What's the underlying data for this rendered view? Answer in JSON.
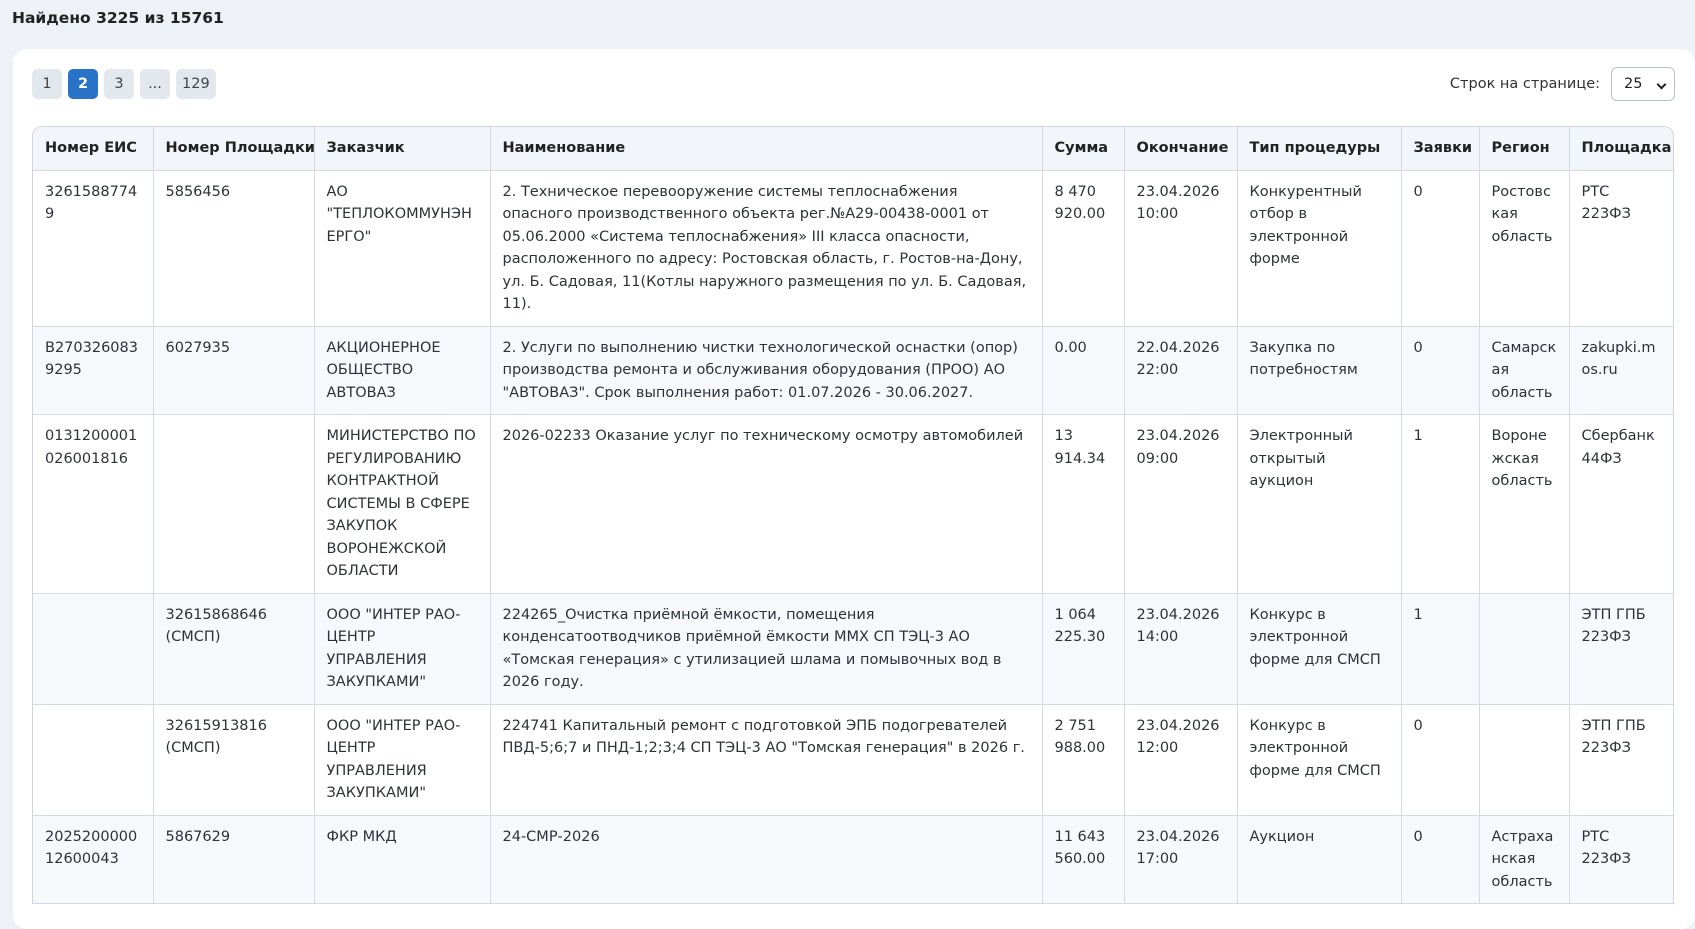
{
  "summary": {
    "found_text": "Найдено 3225 из 15761"
  },
  "pagination": {
    "pages": [
      "1",
      "2",
      "3",
      "...",
      "129"
    ],
    "active_index": 1
  },
  "page_size": {
    "label": "Строк на странице:",
    "value": "25"
  },
  "table": {
    "headers": [
      "Номер ЕИС",
      "Номер Площадки",
      "Заказчик",
      "Наименование",
      "Сумма",
      "Окончание",
      "Тип процедуры",
      "Заявки",
      "Регион",
      "Площадка"
    ],
    "rows": [
      [
        "32615887749",
        "5856456",
        "АО \"ТЕПЛОКОММУНЭНЕРГО\"",
        "2. Техническое перевооружение системы теплоснабжения опасного производственного объекта рег.№А29-00438-0001 от 05.06.2000 «Система теплоснабжения» III класса опасности, расположенного по адресу: Ростовская область, г. Ростов-на-Дону, ул. Б. Садовая, 11(Котлы наружного размещения по ул. Б. Садовая, 11).",
        "8 470 920.00",
        "23.04.2026 10:00",
        "Конкурентный отбор в электронной форме",
        "0",
        "Ростовская область",
        "РТС 223ФЗ"
      ],
      [
        "B2703260839295",
        "6027935",
        "АКЦИОНЕРНОЕ ОБЩЕСТВО АВТОВАЗ",
        "2. Услуги по выполнению чистки технологической оснастки (опор) производства ремонта и обслуживания оборудования (ПРОО) АО \"АВТОВАЗ\". Срок выполнения работ: 01.07.2026 - 30.06.2027.",
        "0.00",
        "22.04.2026 22:00",
        "Закупка по потребностям",
        "0",
        "Самарская область",
        "zakupki.mos.ru"
      ],
      [
        "0131200001026001816",
        "",
        "МИНИСТЕРСТВО ПО РЕГУЛИРОВАНИЮ КОНТРАКТНОЙ СИСТЕМЫ В СФЕРЕ ЗАКУПОК ВОРОНЕЖСКОЙ ОБЛАСТИ",
        "2026-02233 Оказание услуг по техническому осмотру автомобилей",
        "13 914.34",
        "23.04.2026 09:00",
        "Электронный открытый аукцион",
        "1",
        "Воронежская область",
        "Сбербанк 44ФЗ"
      ],
      [
        "",
        "32615868646 (СМСП)",
        "ООО \"ИНТЕР РАО-ЦЕНТР УПРАВЛЕНИЯ ЗАКУПКАМИ\"",
        "224265_Очистка приёмной ёмкости, помещения конденсатоотводчиков приёмной ёмкости ММХ СП ТЭЦ-3 АО «Томская генерация» с утилизацией шлама и помывочных вод в 2026 году.",
        "1 064 225.30",
        "23.04.2026 14:00",
        "Конкурс в электронной форме для СМСП",
        "1",
        "",
        "ЭТП ГПБ 223ФЗ"
      ],
      [
        "",
        "32615913816 (СМСП)",
        "ООО \"ИНТЕР РАО-ЦЕНТР УПРАВЛЕНИЯ ЗАКУПКАМИ\"",
        "224741 Капитальный ремонт с подготовкой ЭПБ подогревателей ПВД-5;6;7 и ПНД-1;2;3;4 СП ТЭЦ-3 АО \"Томская генерация\" в 2026 г.",
        "2 751 988.00",
        "23.04.2026 12:00",
        "Конкурс в электронной форме для СМСП",
        "0",
        "",
        "ЭТП ГПБ 223ФЗ"
      ],
      [
        "202520000012600043",
        "5867629",
        "ФКР МКД",
        "24-СМР-2026",
        "11 643 560.00",
        "23.04.2026 17:00",
        "Аукцион",
        "0",
        "Астраханская область",
        "РТС 223ФЗ"
      ]
    ]
  },
  "colors": {
    "accent": "#2873c8",
    "page_bg": "#eef1f6",
    "header_bg": "#f2f5f9"
  }
}
